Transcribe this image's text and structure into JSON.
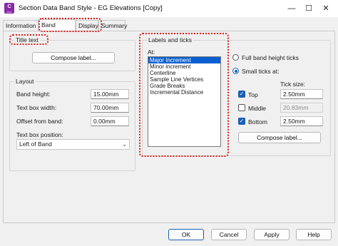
{
  "window": {
    "title": "Section Data Band Style - EG Elevations [Copy]",
    "app_icon_letter": "C",
    "app_icon_sub": "CIVIL",
    "minimize_glyph": "—",
    "maximize_glyph": "☐",
    "close_glyph": "✕"
  },
  "tabs": [
    "Information",
    "Band Details",
    "Display",
    "Summary"
  ],
  "title_text": {
    "label": "Title text",
    "compose_button": "Compose label..."
  },
  "layout": {
    "label": "Layout",
    "band_height_label": "Band height:",
    "band_height_value": "15.00mm",
    "text_box_width_label": "Text box width:",
    "text_box_width_value": "70.00mm",
    "offset_label": "Offset from band:",
    "offset_value": "0.00mm",
    "text_box_position_label": "Text box position:",
    "text_box_position_value": "Left of Band"
  },
  "labels_ticks": {
    "label": "Labels and ticks",
    "at_label": "At:",
    "at_items": [
      "Major Increment",
      "Minor increment",
      "Centerline",
      "Sample Line Vertices",
      "Grade Breaks",
      "Incremental Distance"
    ],
    "selected_index": 0,
    "full_band_label": "Full band height ticks",
    "small_ticks_label": "Small ticks at:",
    "tick_size_label": "Tick size:",
    "top_label": "Top",
    "top_value": "2.50mm",
    "middle_label": "Middle",
    "middle_value": "20.83mm",
    "bottom_label": "Bottom",
    "bottom_value": "2.50mm",
    "compose_button": "Compose label..."
  },
  "footer": {
    "ok": "OK",
    "cancel": "Cancel",
    "apply": "Apply",
    "help": "Help"
  },
  "colors": {
    "accent": "#1a5fb4",
    "highlight": "#d6201f",
    "app_icon": "#8a2aa8"
  }
}
